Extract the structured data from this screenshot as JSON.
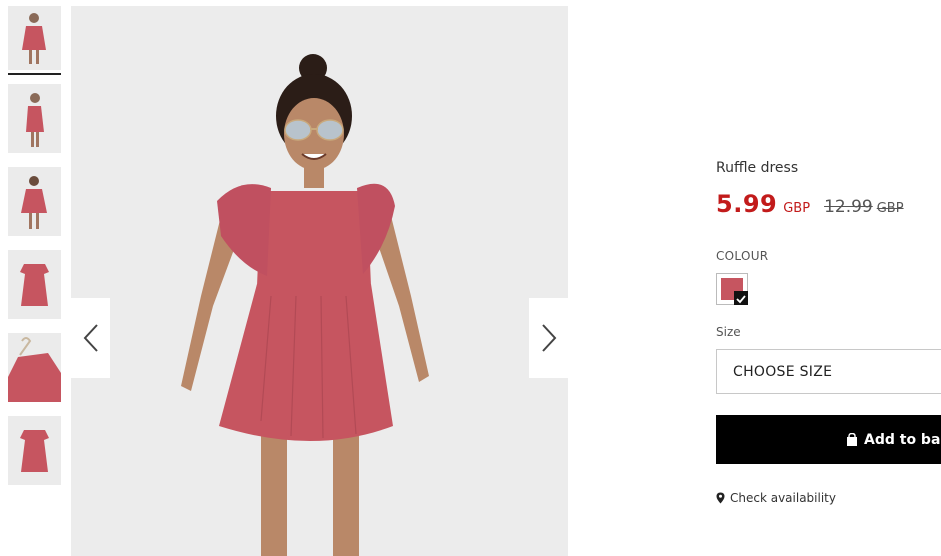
{
  "thumbnails": [
    {
      "label": "front view"
    },
    {
      "label": "side view"
    },
    {
      "label": "back view"
    },
    {
      "label": "flat front"
    },
    {
      "label": "hanger detail"
    },
    {
      "label": "flat back"
    }
  ],
  "colors": {
    "dress": "#c65560",
    "sale_price": "#c21b1b",
    "button_bg": "#000000",
    "background": "#ececec"
  },
  "product": {
    "title": "Ruffle dress",
    "sale_price": "5.99",
    "sale_currency": "GBP",
    "original_price": "12.99",
    "original_currency": "GBP",
    "colour_label": "COLOUR",
    "size_label": "Size",
    "size_placeholder": "CHOOSE SIZE",
    "add_to_bag": "Add to bag",
    "check_availability": "Check availability"
  },
  "icons": {
    "prev": "chevron-left-icon",
    "next": "chevron-right-icon",
    "bag": "shopping-bag-icon",
    "location": "location-pin-icon",
    "check": "check-icon"
  }
}
